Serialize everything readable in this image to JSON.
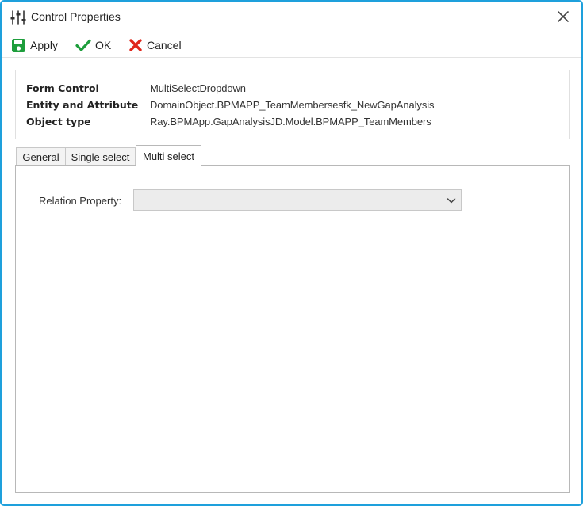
{
  "window": {
    "title": "Control Properties",
    "border_color": "#1ea0dc",
    "icons": {
      "title": "sliders-icon",
      "close": "close-icon"
    }
  },
  "toolbar": {
    "apply_label": "Apply",
    "ok_label": "OK",
    "cancel_label": "Cancel",
    "icons": {
      "apply": "save-icon",
      "ok": "checkmark-icon",
      "cancel": "x-icon"
    },
    "colors": {
      "apply": "#1e9e3c",
      "ok": "#1e9e3c",
      "cancel": "#e0271c"
    }
  },
  "info": {
    "form_control_label": "Form Control",
    "form_control_value": "MultiSelectDropdown",
    "entity_label": "Entity and Attribute",
    "entity_value": "DomainObject.BPMAPP_TeamMembersesfk_NewGapAnalysis",
    "object_type_label": "Object type",
    "object_type_value": "Ray.BPMApp.GapAnalysisJD.Model.BPMAPP_TeamMembers"
  },
  "tabs": [
    {
      "label": "General",
      "active": false
    },
    {
      "label": "Single select",
      "active": false
    },
    {
      "label": "Multi select",
      "active": true
    }
  ],
  "multi_select": {
    "relation_property_label": "Relation Property:",
    "relation_property_value": "",
    "dropdown_icon": "chevron-down-icon"
  }
}
